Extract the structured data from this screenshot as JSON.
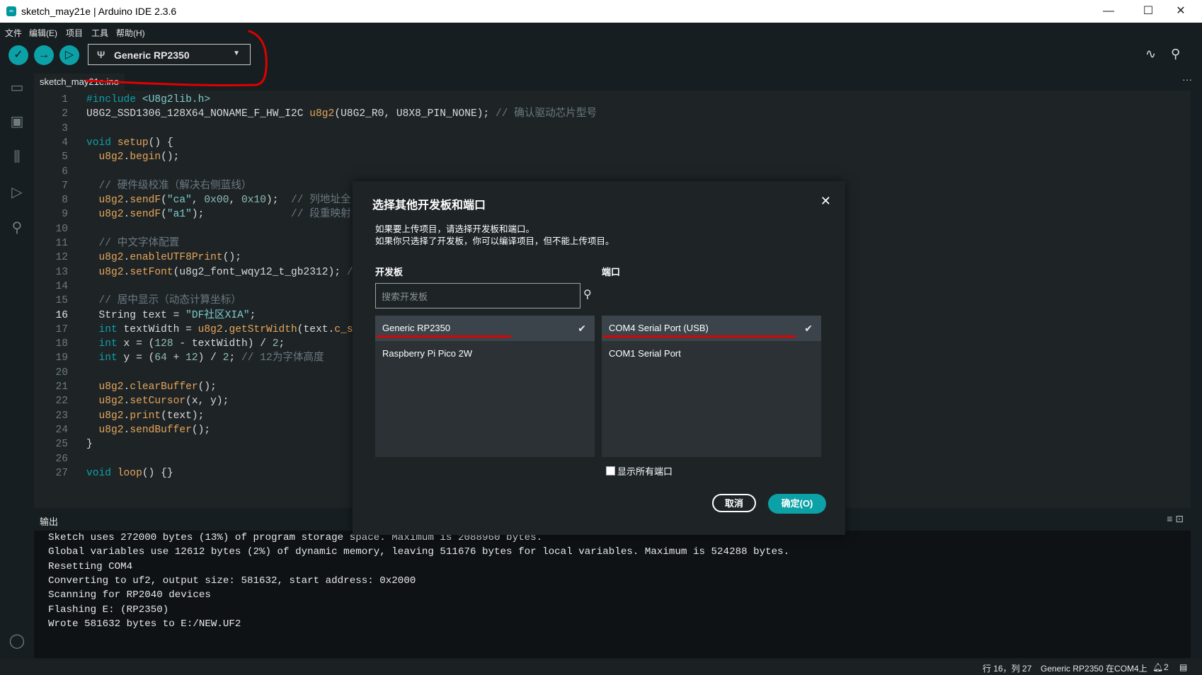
{
  "window": {
    "title": "sketch_may21e | Arduino IDE 2.3.6",
    "controls": [
      "—",
      "☐",
      "✕"
    ]
  },
  "menu": [
    "文件",
    "编辑(E)",
    "项目",
    "工具",
    "帮助(H)"
  ],
  "toolbar": {
    "board": "Generic RP2350"
  },
  "tab": {
    "filename": "sketch_may21e.ino"
  },
  "code_lines": [
    {
      "n": "1",
      "html": "<span class='k'>#include</span> <span class='s'>&lt;U8g2lib.h&gt;</span>"
    },
    {
      "n": "2",
      "html": "U8G2_SSD1306_128X64_NONAME_F_HW_I2C <span class='f'>u8g2</span>(U8G2_R0, U8X8_PIN_NONE); <span class='c'>// 确认驱动芯片型号</span>"
    },
    {
      "n": "3",
      "html": ""
    },
    {
      "n": "4",
      "html": "<span class='k'>void</span> <span class='f'>setup</span>() {"
    },
    {
      "n": "5",
      "html": "  <span class='f'>u8g2</span>.<span class='f'>begin</span>();"
    },
    {
      "n": "6",
      "html": ""
    },
    {
      "n": "7",
      "html": "  <span class='c'>// 硬件级校准（解决右侧蓝线）</span>"
    },
    {
      "n": "8",
      "html": "  <span class='f'>u8g2</span>.<span class='f'>sendF</span>(<span class='s'>\"ca\"</span>, <span class='n'>0x00</span>, <span class='n'>0x10</span>);  <span class='c'>// 列地址全</span>"
    },
    {
      "n": "9",
      "html": "  <span class='f'>u8g2</span>.<span class='f'>sendF</span>(<span class='s'>\"a1\"</span>);              <span class='c'>// 段重映射</span>"
    },
    {
      "n": "10",
      "html": ""
    },
    {
      "n": "11",
      "html": "  <span class='c'>// 中文字体配置</span>"
    },
    {
      "n": "12",
      "html": "  <span class='f'>u8g2</span>.<span class='f'>enableUTF8Print</span>();"
    },
    {
      "n": "13",
      "html": "  <span class='f'>u8g2</span>.<span class='f'>setFont</span>(u8g2_font_wqy12_t_gb2312); <span class='c'>/</span>"
    },
    {
      "n": "14",
      "html": ""
    },
    {
      "n": "15",
      "html": "  <span class='c'>// 居中显示（动态计算坐标）</span>"
    },
    {
      "n": "16",
      "html": "  String text = <span class='s'>\"DF社区XIA\"</span>;"
    },
    {
      "n": "17",
      "html": "  <span class='k'>int</span> textWidth = <span class='f'>u8g2</span>.<span class='f'>getStrWidth</span>(text.<span class='f'>c_s</span>"
    },
    {
      "n": "18",
      "html": "  <span class='k'>int</span> x = (<span class='n'>128</span> - textWidth) / <span class='n'>2</span>;"
    },
    {
      "n": "19",
      "html": "  <span class='k'>int</span> y = (<span class='n'>64</span> + <span class='n'>12</span>) / <span class='n'>2</span>; <span class='c'>// 12为字体高度</span>"
    },
    {
      "n": "20",
      "html": ""
    },
    {
      "n": "21",
      "html": "  <span class='f'>u8g2</span>.<span class='f'>clearBuffer</span>();"
    },
    {
      "n": "22",
      "html": "  <span class='f'>u8g2</span>.<span class='f'>setCursor</span>(x, y);"
    },
    {
      "n": "23",
      "html": "  <span class='f'>u8g2</span>.<span class='f'>print</span>(text);"
    },
    {
      "n": "24",
      "html": "  <span class='f'>u8g2</span>.<span class='f'>sendBuffer</span>();"
    },
    {
      "n": "25",
      "html": "}"
    },
    {
      "n": "26",
      "html": ""
    },
    {
      "n": "27",
      "html": "<span class='k'>void</span> <span class='f'>loop</span>() {}"
    }
  ],
  "output": {
    "title": "输出",
    "lines": [
      "Sketch uses 272000 bytes (13%) of program storage space. Maximum is 2088960 bytes.",
      "Global variables use 12612 bytes (2%) of dynamic memory, leaving 511676 bytes for local variables. Maximum is 524288 bytes.",
      "Resetting COM4",
      "Converting to uf2, output size: 581632, start address: 0x2000",
      "Scanning for RP2040 devices",
      "Flashing E: (RP2350)",
      "Wrote 581632 bytes to E:/NEW.UF2"
    ]
  },
  "status": {
    "position": "行 16，列 27",
    "board_port": "Generic RP2350 在COM4上",
    "notifications": "2"
  },
  "dialog": {
    "title": "选择其他开发板和端口",
    "desc_line1": "如果要上传项目，请选择开发板和端口。",
    "desc_line2": "如果你只选择了开发板，你可以编译项目，但不能上传项目。",
    "boards_label": "开发板",
    "ports_label": "端口",
    "search_placeholder": "搜索开发板",
    "boards": [
      {
        "name": "Generic RP2350",
        "selected": true
      },
      {
        "name": "Raspberry Pi Pico 2W",
        "selected": false
      }
    ],
    "ports": [
      {
        "name": "COM4 Serial Port (USB)",
        "selected": true
      },
      {
        "name": "COM1 Serial Port",
        "selected": false
      }
    ],
    "show_all_ports": "显示所有端口",
    "cancel": "取消",
    "ok": "确定(O)"
  },
  "colors": {
    "accent": "#0ca1a6",
    "annotation": "#e00000"
  }
}
